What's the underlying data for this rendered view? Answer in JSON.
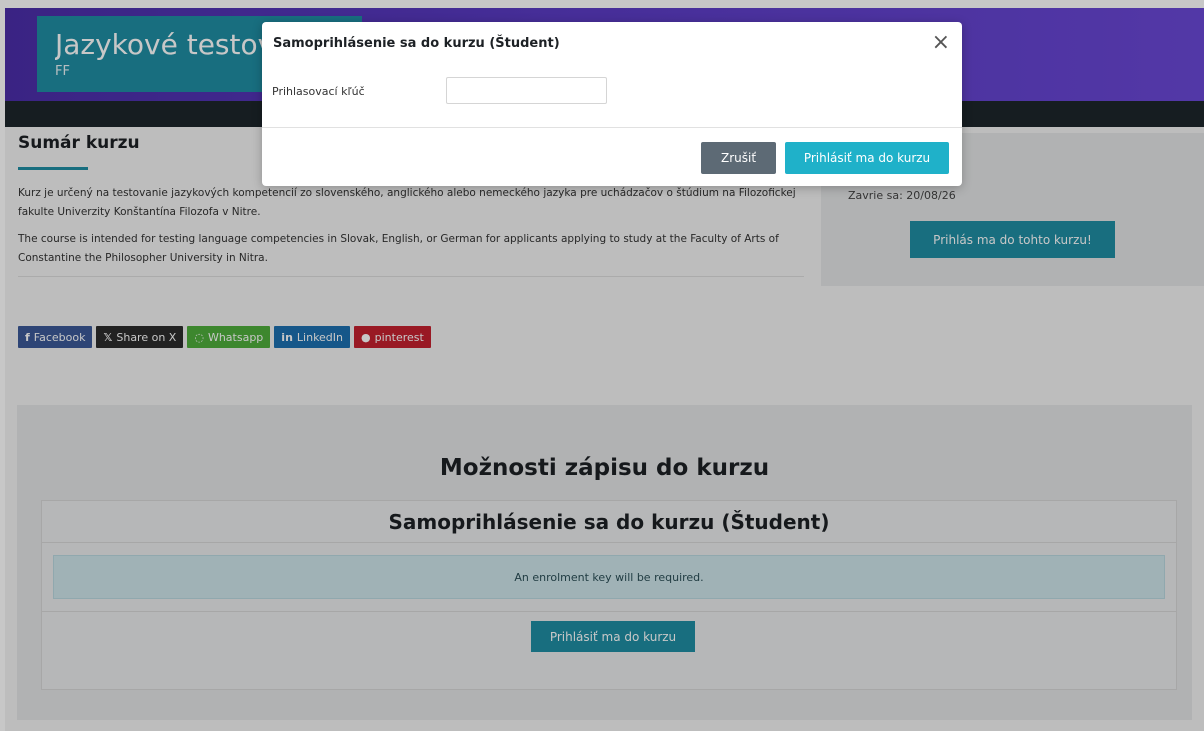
{
  "header": {
    "title": "Jazykové testovanie",
    "subtitle": "FF"
  },
  "summary": {
    "heading": "Sumár kurzu",
    "paragraph_sk": "Kurz je určený na testovanie jazykových kompetencií zo slovenského, anglického alebo nemeckého jazyka pre uchádzačov o štúdium na Filozofickej fakulte Univerzity Konštantína Filozofa v Nitre.",
    "paragraph_en": "The course is intended for testing language competencies in Slovak, English, or German for applicants applying to study at the Faculty of Arts of Constantine the Philosopher University in Nitra."
  },
  "share": {
    "facebook": "Facebook",
    "x": "Share on X",
    "whatsapp": "Whatsapp",
    "linkedin": "LinkedIn",
    "pinterest": "pinterest"
  },
  "sidebar": {
    "closes": "Zavrie sa: 20/08/26",
    "enroll_button": "Prihlás ma do tohto kurzu!"
  },
  "enrolment": {
    "heading": "Možnosti zápisu do kurzu",
    "method_title": "Samoprihlásenie sa do kurzu (Študent)",
    "key_note": "An enrolment key will be required.",
    "button": "Prihlásiť ma do kurzu"
  },
  "modal": {
    "title": "Samoprihlásenie sa do kurzu (Študent)",
    "close_glyph": "×",
    "key_label": "Prihlasovací kľúč",
    "key_value": "",
    "cancel": "Zrušiť",
    "submit": "Prihlásiť ma do kurzu"
  },
  "colors": {
    "accent": "#1f8ea3",
    "modal_submit": "#1fb1c9",
    "cancel": "#5d6a75",
    "hero": "#5a3bc3"
  }
}
